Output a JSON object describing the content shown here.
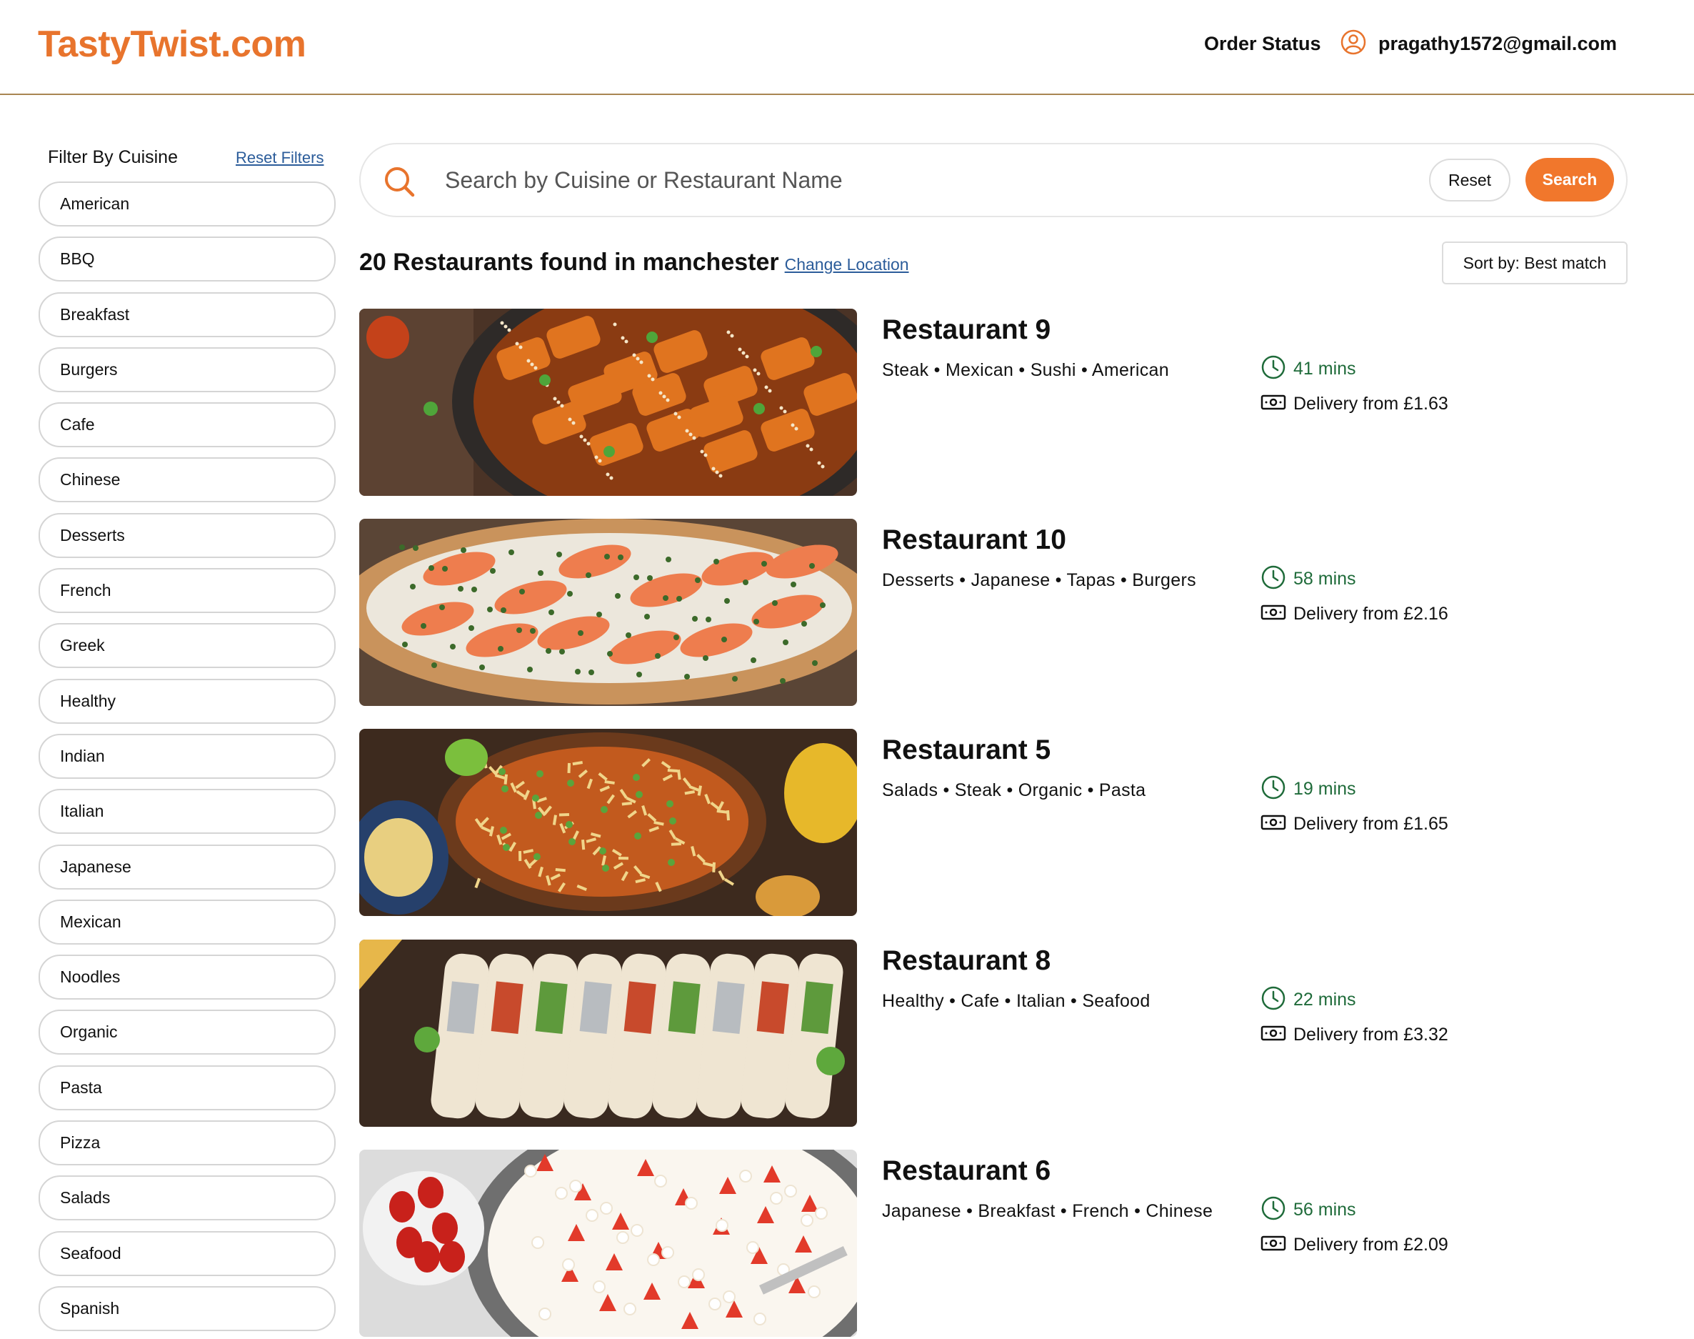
{
  "header": {
    "logo": "TastyTwist.com",
    "order_status": "Order Status",
    "user_email": "pragathy1572@gmail.com"
  },
  "sidebar": {
    "title": "Filter By Cuisine",
    "reset_label": "Reset Filters",
    "cuisines": [
      "American",
      "BBQ",
      "Breakfast",
      "Burgers",
      "Cafe",
      "Chinese",
      "Desserts",
      "French",
      "Greek",
      "Healthy",
      "Indian",
      "Italian",
      "Japanese",
      "Mexican",
      "Noodles",
      "Organic",
      "Pasta",
      "Pizza",
      "Salads",
      "Seafood",
      "Spanish"
    ]
  },
  "search": {
    "placeholder": "Search by Cuisine or Restaurant Name",
    "reset_label": "Reset",
    "search_label": "Search"
  },
  "results": {
    "summary": "20 Restaurants found in manchester",
    "change_location": "Change Location",
    "sort_label": "Sort by: Best match"
  },
  "restaurants": [
    {
      "name": "Restaurant 9",
      "cuisines": "Steak  •  Mexican  •  Sushi  •  American",
      "time": "41 mins",
      "delivery": "Delivery from £1.63",
      "image": "glazed-potatoes-dish"
    },
    {
      "name": "Restaurant 10",
      "cuisines": "Desserts  •  Japanese  •  Tapas  •  Burgers",
      "time": "58 mins",
      "delivery": "Delivery from £2.16",
      "image": "salmon-flatbread"
    },
    {
      "name": "Restaurant 5",
      "cuisines": "Salads  •  Steak  •  Organic  •  Pasta",
      "time": "19 mins",
      "delivery": "Delivery from £1.65",
      "image": "enchilada-casserole"
    },
    {
      "name": "Restaurant 8",
      "cuisines": "Healthy  •  Cafe  •  Italian  •  Seafood",
      "time": "22 mins",
      "delivery": "Delivery from £3.32",
      "image": "burrito-wraps"
    },
    {
      "name": "Restaurant 6",
      "cuisines": "Japanese  •  Breakfast  •  French  •  Chinese",
      "time": "56 mins",
      "delivery": "Delivery from £2.09",
      "image": "strawberry-cake"
    }
  ],
  "colors": {
    "brand": "#e8742d",
    "search_button": "#f1772c",
    "link": "#2b5c9a",
    "time_green": "#1f6b3a"
  }
}
